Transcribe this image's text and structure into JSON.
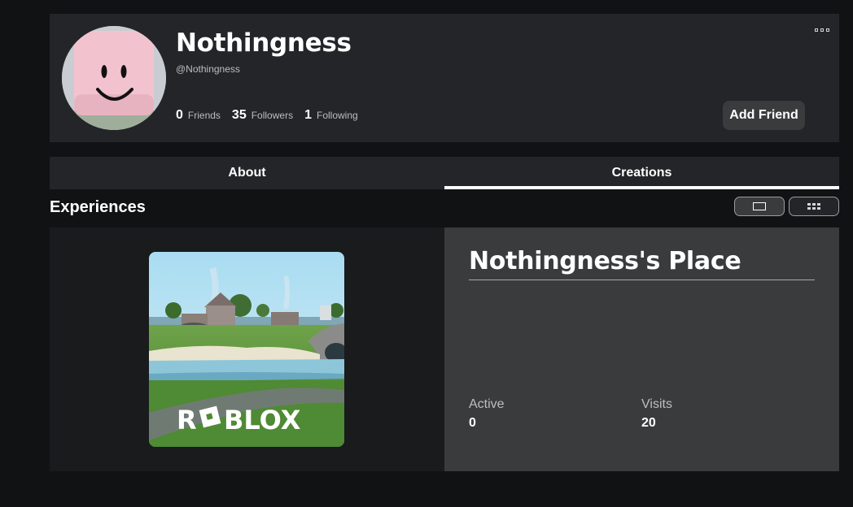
{
  "profile": {
    "display_name": "Nothingness",
    "username": "@Nothingness",
    "friends_count": "0",
    "friends_label": "Friends",
    "followers_count": "35",
    "followers_label": "Followers",
    "following_count": "1",
    "following_label": "Following",
    "add_friend_label": "Add Friend",
    "more_icon": "ellipsis-icon"
  },
  "tabs": [
    {
      "label": "About",
      "active": false
    },
    {
      "label": "Creations",
      "active": true
    }
  ],
  "experiences": {
    "title": "Experiences",
    "view_single_icon": "single-view-icon",
    "view_grid_icon": "grid-view-icon",
    "items": [
      {
        "name": "Nothingness's Place",
        "thumbnail_text": "ROBLOX",
        "active_label": "Active",
        "active_value": "0",
        "visits_label": "Visits",
        "visits_value": "20"
      }
    ]
  },
  "colors": {
    "background": "#111214",
    "card": "#232529",
    "card_dark": "#191b1d",
    "card_light": "#393b3d",
    "text_muted": "#bdbec0",
    "avatar_pink": "#f2c3cf"
  }
}
